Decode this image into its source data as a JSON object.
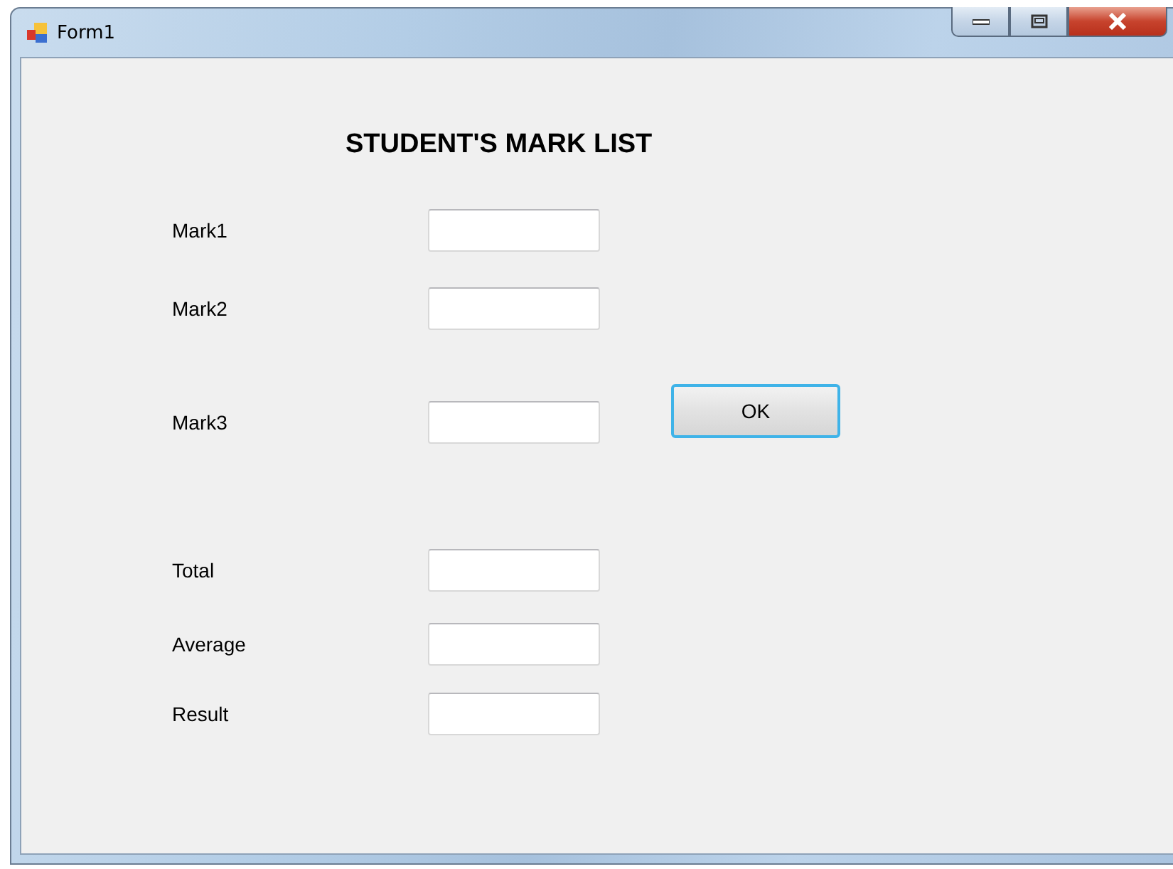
{
  "window": {
    "title": "Form1"
  },
  "heading": "STUDENT'S MARK LIST",
  "fields": [
    {
      "label": "Mark1"
    },
    {
      "label": "Mark2"
    },
    {
      "label": "Mark3",
      "button": "OK"
    },
    {
      "label": "Total"
    },
    {
      "label": "Average"
    },
    {
      "label": "Result"
    }
  ]
}
